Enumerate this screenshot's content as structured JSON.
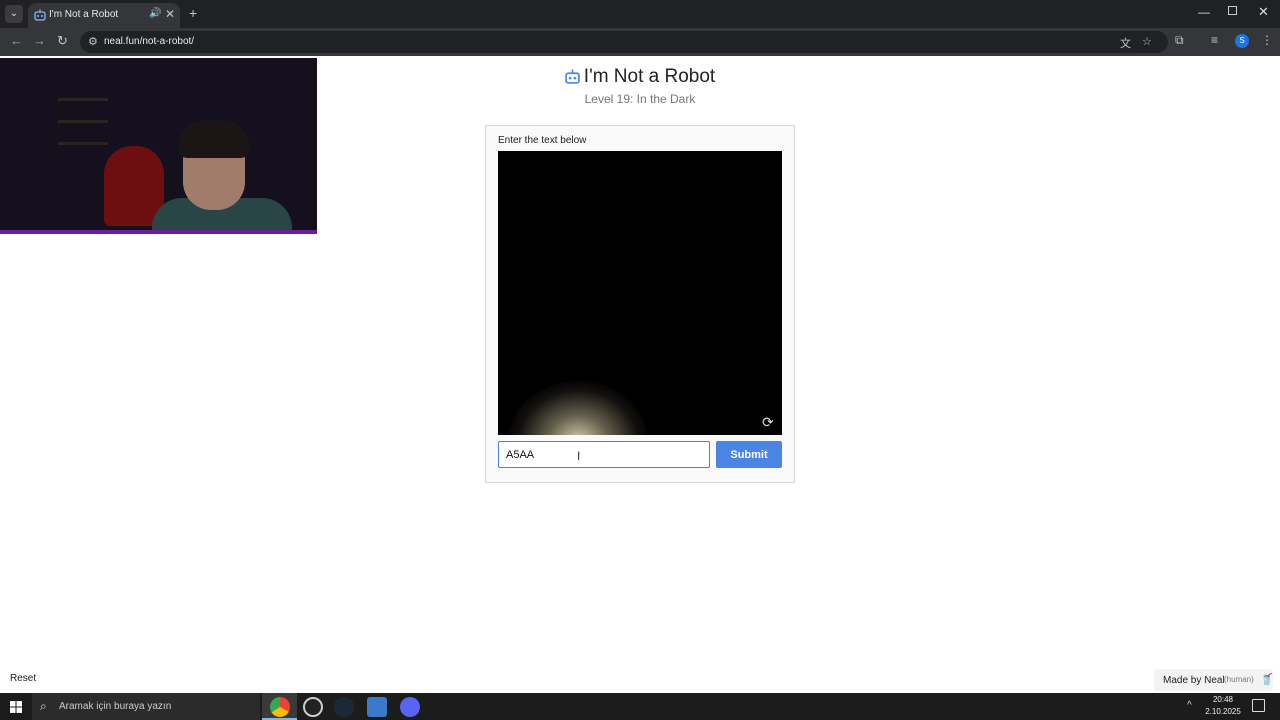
{
  "browser": {
    "tab_title": "I'm Not a Robot",
    "new_tab_label": "+",
    "url": "neal.fun/not-a-robot/",
    "profile_initial": "S"
  },
  "page": {
    "title": "I'm Not a Robot",
    "level": "Level 19: In the Dark",
    "prompt": "Enter the text below",
    "answer_value": "A5AA",
    "submit_label": "Submit",
    "reset_label": "Reset",
    "made_by": "Made by Neal",
    "human_tag": "(human)",
    "accent": "#4a85e6"
  },
  "taskbar": {
    "search_placeholder": "Aramak için buraya yazın",
    "time": "20:48",
    "date": "2.10.2025",
    "apps": [
      "chrome-icon",
      "obs-icon",
      "steam-icon",
      "app-icon",
      "discord-icon"
    ]
  }
}
